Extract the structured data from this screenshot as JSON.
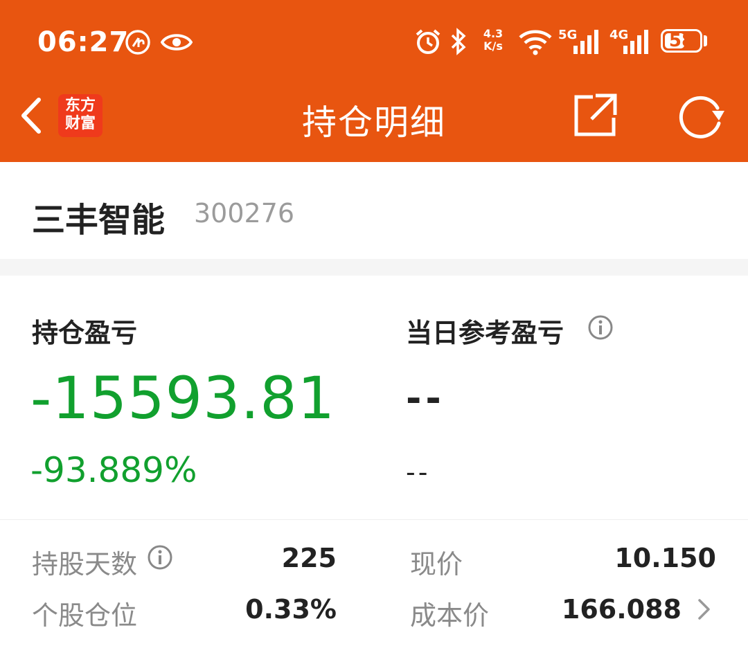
{
  "status_bar": {
    "time": "06:27",
    "net_speed_line1": "4.3",
    "net_speed_line2": "K/s",
    "signal1_label": "5G",
    "signal2_label": "4G",
    "battery": "58",
    "battery_level": 0.58
  },
  "nav": {
    "logo_line1": "东方",
    "logo_line2": "财富",
    "title": "持仓明细"
  },
  "stock": {
    "name": "三丰智能",
    "code": "300276"
  },
  "holding_pl": {
    "label": "持仓盈亏",
    "value": "-15593.81",
    "percent": "-93.889%"
  },
  "daily_pl": {
    "label": "当日参考盈亏",
    "value": "--",
    "percent": "--"
  },
  "stats": {
    "hold_days_label": "持股天数",
    "hold_days_value": "225",
    "position_label": "个股仓位",
    "position_value": "0.33%",
    "price_label": "现价",
    "price_value": "10.150",
    "cost_label": "成本价",
    "cost_value": "166.088"
  },
  "colors": {
    "header": "#e85510",
    "loss_green": "#11a02e",
    "logo_red": "#ef3a1c"
  }
}
